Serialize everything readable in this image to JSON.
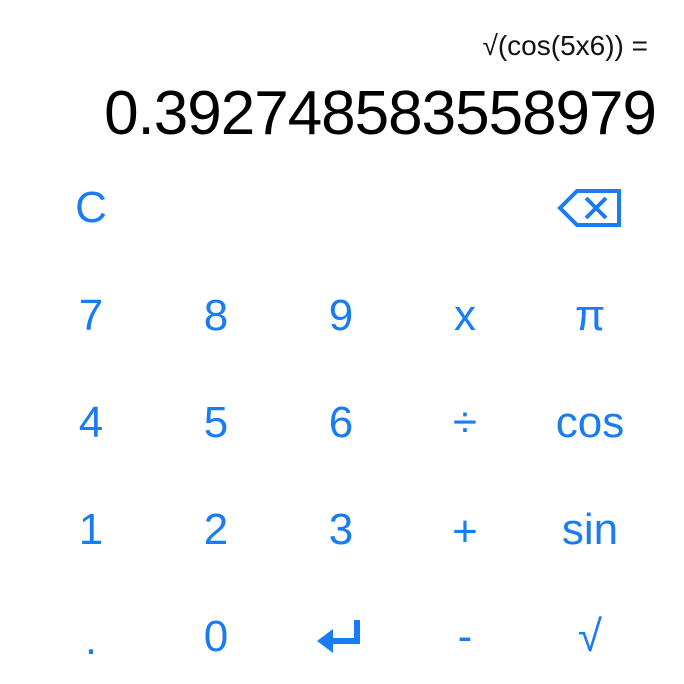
{
  "display": {
    "expression": "√(cos(5x6)) =",
    "result": "0.392748583558979"
  },
  "keys": {
    "clear": "C",
    "backspace_icon": "backspace-icon",
    "k7": "7",
    "k8": "8",
    "k9": "9",
    "multiply": "x",
    "pi": "π",
    "k4": "4",
    "k5": "5",
    "k6": "6",
    "divide": "÷",
    "cos": "cos",
    "k1": "1",
    "k2": "2",
    "k3": "3",
    "plus": "+",
    "sin": "sin",
    "dot": ".",
    "k0": "0",
    "enter_icon": "return-arrow-icon",
    "minus": "-",
    "sqrt": "√"
  },
  "colors": {
    "accent": "#1a7cf3",
    "display_text": "#000000",
    "background": "#ffffff"
  }
}
